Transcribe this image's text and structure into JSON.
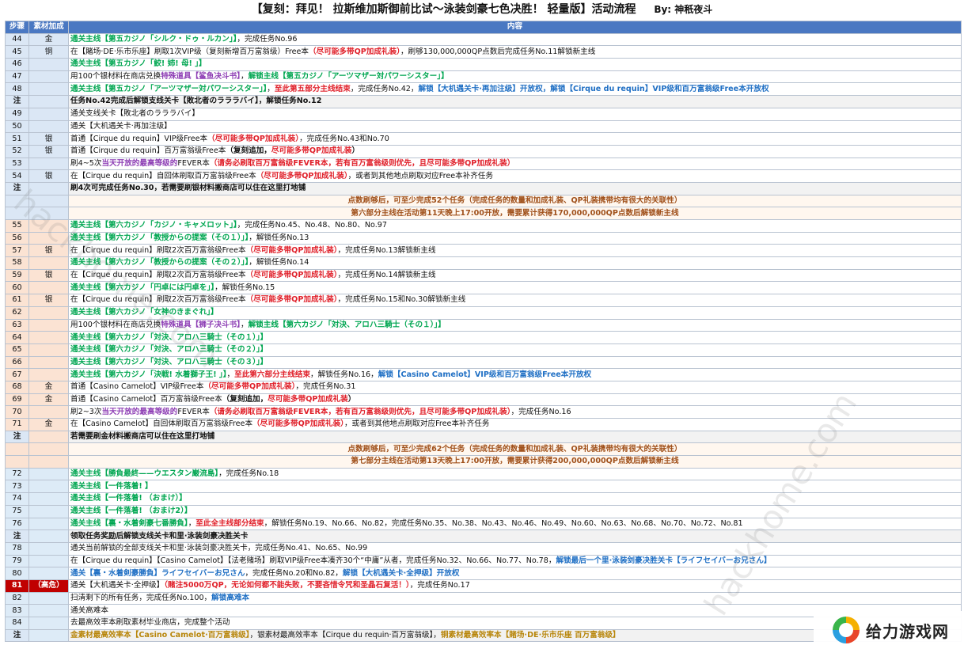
{
  "title": "【复刻：拜见！ 拉斯维加斯御前比试～泳装剑豪七色决胜！ 轻量版】活动流程",
  "author": "By:  神秖夜斗",
  "columns": [
    "步骤",
    "素材加成",
    "内容"
  ],
  "watermark": "hackhome.com",
  "watermark_left": "hackhome.com",
  "logo_text": "给力游戏网",
  "rows": [
    {
      "step": "44",
      "mat": "金",
      "band": "blue",
      "kind": "normal",
      "parts": [
        {
          "t": "通关主线【第五カジノ「シルク・ドゥ・ルカン」】",
          "c": "g"
        },
        {
          "t": "，完成任务No.96",
          "c": "n"
        }
      ]
    },
    {
      "step": "45",
      "mat": "铜",
      "band": "blue",
      "kind": "normal",
      "parts": [
        {
          "t": "在【賭场·DE·乐市乐座】刷取1次VIP级（复刻新增百万富翁级）Free本",
          "c": "n"
        },
        {
          "t": "（尽可能多带QP加成礼装）",
          "c": "r"
        },
        {
          "t": "，刷够130,000,000QP点数后完成任务No.11解锁新主线",
          "c": "n"
        }
      ]
    },
    {
      "step": "46",
      "mat": "",
      "band": "blue",
      "kind": "normal",
      "parts": [
        {
          "t": "通关主线【第五カジノ「鮫! 姉! 母! 」】",
          "c": "g"
        }
      ]
    },
    {
      "step": "47",
      "mat": "",
      "band": "blue",
      "kind": "normal",
      "parts": [
        {
          "t": "用100个银材料在商店兑换",
          "c": "n"
        },
        {
          "t": "特殊道具【鲨鱼决斗书】",
          "c": "p"
        },
        {
          "t": "，",
          "c": "n"
        },
        {
          "t": "解锁主线【第五カジノ「アーツマザー対パワーシスター」】",
          "c": "g"
        }
      ]
    },
    {
      "step": "48",
      "mat": "",
      "band": "blue",
      "kind": "normal",
      "parts": [
        {
          "t": "通关主线【第五カジノ「アーツマザー対パワーシスター」】",
          "c": "g"
        },
        {
          "t": "，",
          "c": "n"
        },
        {
          "t": "至此第五部分主线结束",
          "c": "r"
        },
        {
          "t": "，完成任务No.42，",
          "c": "n"
        },
        {
          "t": "解锁【大机遇关卡·再加注级】开放权，解锁【Cirque du requin】VIP级和百万富翁级Free本开放权",
          "c": "b"
        }
      ]
    },
    {
      "step": "注",
      "mat": "",
      "band": "blue",
      "kind": "note",
      "parts": [
        {
          "t": "任务No.42完成后解锁支线关卡【敗北者のラララバイ】，解锁任务No.12",
          "c": "k"
        }
      ]
    },
    {
      "step": "49",
      "mat": "",
      "band": "blue",
      "kind": "normal",
      "parts": [
        {
          "t": "通关支线关卡【敗北者のラララバイ】",
          "c": "n"
        }
      ]
    },
    {
      "step": "50",
      "mat": "",
      "band": "blue",
      "kind": "normal",
      "parts": [
        {
          "t": "通关【大机遇关卡·再加注级】",
          "c": "n"
        }
      ]
    },
    {
      "step": "51",
      "mat": "银",
      "band": "blue",
      "kind": "normal",
      "parts": [
        {
          "t": "首通【Cirque du requin】VIP级Free本",
          "c": "n"
        },
        {
          "t": "（尽可能多带QP加成礼装）",
          "c": "r"
        },
        {
          "t": "，完成任务No.43和No.70",
          "c": "n"
        }
      ]
    },
    {
      "step": "52",
      "mat": "银",
      "band": "blue",
      "kind": "normal",
      "parts": [
        {
          "t": "首通【Cirque du requin】百万富翁级Free本",
          "c": "n"
        },
        {
          "t": "（复刻追加，",
          "c": "k"
        },
        {
          "t": "尽可能多带QP加成礼装",
          "c": "r"
        },
        {
          "t": "）",
          "c": "k"
        }
      ]
    },
    {
      "step": "53",
      "mat": "",
      "band": "blue",
      "kind": "normal",
      "parts": [
        {
          "t": "刷4~5次",
          "c": "n"
        },
        {
          "t": "当天开放的最高等级的",
          "c": "p"
        },
        {
          "t": "FEVER本",
          "c": "n"
        },
        {
          "t": "（请务必刷取百万富翁级FEVER本，若有百万富翁级则优先，且尽可能多带QP加成礼装）",
          "c": "r"
        }
      ]
    },
    {
      "step": "54",
      "mat": "银",
      "band": "blue",
      "kind": "normal",
      "parts": [
        {
          "t": "在【Cirque du requin】自回体刷取百万富翁级Free本",
          "c": "n"
        },
        {
          "t": "（尽可能多带QP加成礼装）",
          "c": "r"
        },
        {
          "t": "，或者到其他地点刷取对应Free本补齐任务",
          "c": "n"
        }
      ]
    },
    {
      "step": "注",
      "mat": "",
      "band": "blue",
      "kind": "note",
      "parts": [
        {
          "t": "刷4次可完成任务No.30，若需要刷银材料搬商店可以住在这里打地铺",
          "c": "k"
        }
      ]
    },
    {
      "step": "",
      "mat": "",
      "band": "blue",
      "kind": "info",
      "parts": [
        {
          "t": "点数刷够后，可至少完成52个任务（完成任务的数量和加成礼装、QP礼装携带均有很大的关联性）",
          "c": "info"
        }
      ]
    },
    {
      "step": "",
      "mat": "",
      "band": "blue",
      "kind": "info",
      "parts": [
        {
          "t": "第六部分主线在活动第11天晚上17:00开放，需要累计获得170,000,000QP点数后解锁新主线",
          "c": "info"
        }
      ]
    },
    {
      "step": "55",
      "mat": "",
      "band": "peach",
      "kind": "normal",
      "parts": [
        {
          "t": "通关主线【第六カジノ「カジノ・キャメロット」】",
          "c": "g"
        },
        {
          "t": "，完成任务No.45、No.48、No.80、No.97",
          "c": "n"
        }
      ]
    },
    {
      "step": "56",
      "mat": "",
      "band": "peach",
      "kind": "normal",
      "parts": [
        {
          "t": "通关主线【第六カジノ「教授からの提案（その１）」】",
          "c": "g"
        },
        {
          "t": "，解锁任务No.13",
          "c": "n"
        }
      ]
    },
    {
      "step": "57",
      "mat": "银",
      "band": "peach",
      "kind": "normal",
      "parts": [
        {
          "t": "在【Cirque du requin】刷取2次百万富翁级Free本",
          "c": "n"
        },
        {
          "t": "（尽可能多带QP加成礼装）",
          "c": "r"
        },
        {
          "t": "，完成任务No.13解锁新主线",
          "c": "n"
        }
      ]
    },
    {
      "step": "58",
      "mat": "",
      "band": "peach",
      "kind": "normal",
      "parts": [
        {
          "t": "通关主线【第六カジノ「教授からの提案（その２）」】",
          "c": "g"
        },
        {
          "t": "，解锁任务No.14",
          "c": "n"
        }
      ]
    },
    {
      "step": "59",
      "mat": "银",
      "band": "peach",
      "kind": "normal",
      "parts": [
        {
          "t": "在【Cirque du requin】刷取2次百万富翁级Free本",
          "c": "n"
        },
        {
          "t": "（尽可能多带QP加成礼装）",
          "c": "r"
        },
        {
          "t": "，完成任务No.14解锁新主线",
          "c": "n"
        }
      ]
    },
    {
      "step": "60",
      "mat": "",
      "band": "peach",
      "kind": "normal",
      "parts": [
        {
          "t": "通关主线【第六カジノ「円卓には円卓を」】",
          "c": "g"
        },
        {
          "t": "，解锁任务No.15",
          "c": "n"
        }
      ]
    },
    {
      "step": "61",
      "mat": "银",
      "band": "peach",
      "kind": "normal",
      "parts": [
        {
          "t": "在【Cirque du requin】刷取2次百万富翁级Free本",
          "c": "n"
        },
        {
          "t": "（尽可能多带QP加成礼装）",
          "c": "r"
        },
        {
          "t": "，完成任务No.15和No.30解锁新主线",
          "c": "n"
        }
      ]
    },
    {
      "step": "62",
      "mat": "",
      "band": "peach",
      "kind": "normal",
      "parts": [
        {
          "t": "通关主线【第六カジノ「女神のきまぐれ」】",
          "c": "g"
        }
      ]
    },
    {
      "step": "63",
      "mat": "",
      "band": "peach",
      "kind": "normal",
      "parts": [
        {
          "t": "用100个银材料在商店兑换",
          "c": "n"
        },
        {
          "t": "特殊道具【狮子决斗书】",
          "c": "p"
        },
        {
          "t": "，",
          "c": "n"
        },
        {
          "t": "解锁主线【第六カジノ「対決、アロハ三騎士（その１）」】",
          "c": "g"
        }
      ]
    },
    {
      "step": "64",
      "mat": "",
      "band": "peach",
      "kind": "normal",
      "parts": [
        {
          "t": "通关主线【第六カジノ「対決、アロハ三騎士（その１）」】",
          "c": "g"
        }
      ]
    },
    {
      "step": "65",
      "mat": "",
      "band": "peach",
      "kind": "normal",
      "parts": [
        {
          "t": "通关主线【第六カジノ「対決、アロハ三騎士（その２）」】",
          "c": "g"
        }
      ]
    },
    {
      "step": "66",
      "mat": "",
      "band": "peach",
      "kind": "normal",
      "parts": [
        {
          "t": "通关主线【第六カジノ「対決、アロハ三騎士（その３）」】",
          "c": "g"
        }
      ]
    },
    {
      "step": "67",
      "mat": "",
      "band": "peach",
      "kind": "normal",
      "parts": [
        {
          "t": "通关主线【第六カジノ「決戦! 水着獅子王! 」】",
          "c": "g"
        },
        {
          "t": "，",
          "c": "n"
        },
        {
          "t": "至此第六部分主线结束",
          "c": "r"
        },
        {
          "t": "，解锁任务No.16，",
          "c": "n"
        },
        {
          "t": "解锁【Casino Camelot】VIP级和百万富翁级Free本开放权",
          "c": "b"
        }
      ]
    },
    {
      "step": "68",
      "mat": "金",
      "band": "peach",
      "kind": "normal",
      "parts": [
        {
          "t": "首通【Casino Camelot】VIP级Free本",
          "c": "n"
        },
        {
          "t": "（尽可能多带QP加成礼装）",
          "c": "r"
        },
        {
          "t": "，完成任务No.31",
          "c": "n"
        }
      ]
    },
    {
      "step": "69",
      "mat": "金",
      "band": "peach",
      "kind": "normal",
      "parts": [
        {
          "t": "首通【Casino Camelot】百万富翁级Free本",
          "c": "n"
        },
        {
          "t": "（复刻追加，",
          "c": "k"
        },
        {
          "t": "尽可能多带QP加成礼装",
          "c": "r"
        },
        {
          "t": "）",
          "c": "k"
        }
      ]
    },
    {
      "step": "70",
      "mat": "",
      "band": "peach",
      "kind": "normal",
      "parts": [
        {
          "t": "刷2~3次",
          "c": "n"
        },
        {
          "t": "当天开放的最高等级的",
          "c": "p"
        },
        {
          "t": "FEVER本",
          "c": "n"
        },
        {
          "t": "（请务必刷取百万富翁级FEVER本，若有百万富翁级则优先，且尽可能多带QP加成礼装）",
          "c": "r"
        },
        {
          "t": "，完成任务No.16",
          "c": "n"
        }
      ]
    },
    {
      "step": "71",
      "mat": "金",
      "band": "peach",
      "kind": "normal",
      "parts": [
        {
          "t": "在【Casino Camelot】自回体刷取百万富翁级Free本",
          "c": "n"
        },
        {
          "t": "（尽可能多带QP加成礼装）",
          "c": "r"
        },
        {
          "t": "，或者到其他地点刷取对应Free本补齐任务",
          "c": "n"
        }
      ]
    },
    {
      "step": "注",
      "mat": "",
      "band": "peach",
      "kind": "note",
      "parts": [
        {
          "t": "若需要刷金材料搬商店可以住在这里打地铺",
          "c": "k"
        }
      ]
    },
    {
      "step": "",
      "mat": "",
      "band": "peach",
      "kind": "info",
      "parts": [
        {
          "t": "点数刷够后，可至少完成62个任务（完成任务的数量和加成礼装、QP礼装携带均有很大的关联性）",
          "c": "info"
        }
      ]
    },
    {
      "step": "",
      "mat": "",
      "band": "peach",
      "kind": "info",
      "parts": [
        {
          "t": "第七部分主线在活动第13天晚上17:00开放，需要累计获得200,000,000QP点数后解锁新主线",
          "c": "info"
        }
      ]
    },
    {
      "step": "72",
      "mat": "",
      "band": "lblue",
      "kind": "normal",
      "parts": [
        {
          "t": "通关主线【勝負最終——ウエスタン巌流島】",
          "c": "g"
        },
        {
          "t": "，完成任务No.18",
          "c": "n"
        }
      ]
    },
    {
      "step": "73",
      "mat": "",
      "band": "lblue",
      "kind": "normal",
      "parts": [
        {
          "t": "通关主线【一件落着! 】",
          "c": "g"
        }
      ]
    },
    {
      "step": "74",
      "mat": "",
      "band": "lblue",
      "kind": "normal",
      "parts": [
        {
          "t": "通关主线【一件落着! （おまけ）】",
          "c": "g"
        }
      ]
    },
    {
      "step": "75",
      "mat": "",
      "band": "lblue",
      "kind": "normal",
      "parts": [
        {
          "t": "通关主线【一件落着! （おまけ2）】",
          "c": "g"
        }
      ]
    },
    {
      "step": "76",
      "mat": "",
      "band": "lblue",
      "kind": "normal",
      "parts": [
        {
          "t": "通关主线【裏・水着剣豪七番勝負】",
          "c": "g"
        },
        {
          "t": "，",
          "c": "n"
        },
        {
          "t": "至此全主线部分结束",
          "c": "r"
        },
        {
          "t": "，解锁任务No.19、No.66、No.82，完成任务No.35、No.38、No.43、No.46、No.49、No.60、No.63、No.68、No.70、No.72、No.81",
          "c": "n"
        }
      ]
    },
    {
      "step": "注",
      "mat": "",
      "band": "lblue",
      "kind": "note",
      "parts": [
        {
          "t": "领取任务奖励后解锁支线关卡和里·泳装剑豪决胜关卡",
          "c": "k"
        }
      ]
    },
    {
      "step": "78",
      "mat": "",
      "band": "lblue",
      "kind": "normal",
      "parts": [
        {
          "t": "通关当前解锁的全部支线关卡和里·泳装剑豪决胜关卡，完成任务No.41、No.65、No.99",
          "c": "n"
        }
      ]
    },
    {
      "step": "79",
      "mat": "",
      "band": "lblue",
      "kind": "normal",
      "parts": [
        {
          "t": "在【Cirque du requin】【Casino Camelot】【法老赌场】刷取VIP级Free本凑齐30个“中庸”从者，完成任务No.32、No.66、No.77、No.78，",
          "c": "n"
        },
        {
          "t": "解锁最后一个里·泳装剑豪决胜关卡【ライフセイバーお兄さん】",
          "c": "b"
        }
      ]
    },
    {
      "step": "80",
      "mat": "",
      "band": "lblue",
      "kind": "normal",
      "parts": [
        {
          "t": "通关【裏・水着剣豪勝負】ライフセイバーお兄さん",
          "c": "b"
        },
        {
          "t": "，完成任务No.20和No.82，",
          "c": "n"
        },
        {
          "t": "解锁【大机遇关卡·全押级】开放权",
          "c": "b"
        }
      ]
    },
    {
      "step": "81",
      "mat": "（高危）",
      "band": "lblue",
      "kind": "danger",
      "parts": [
        {
          "t": "通关【大机遇关卡·全押级】",
          "c": "n"
        },
        {
          "t": "（赌注5000万QP，无论如何都不能失败，不要吝惜令咒和圣晶石复活！）",
          "c": "r"
        },
        {
          "t": "，完成任务No.17",
          "c": "n"
        }
      ]
    },
    {
      "step": "82",
      "mat": "",
      "band": "lblue",
      "kind": "normal",
      "parts": [
        {
          "t": "扫清剩下的所有任务，完成任务No.100，",
          "c": "n"
        },
        {
          "t": "解锁高难本",
          "c": "b"
        }
      ]
    },
    {
      "step": "83",
      "mat": "",
      "band": "lblue",
      "kind": "normal",
      "parts": [
        {
          "t": "通关高难本",
          "c": "n"
        }
      ]
    },
    {
      "step": "84",
      "mat": "",
      "band": "lblue",
      "kind": "normal",
      "parts": [
        {
          "t": "去最高效率本刷取素材毕业商店，完成整个活动",
          "c": "n"
        }
      ]
    },
    {
      "step": "注",
      "mat": "",
      "band": "lblue",
      "kind": "note",
      "parts": [
        {
          "t": "金素材最高效率本【Casino Camelot·百万富翁级】",
          "c": "o"
        },
        {
          "t": "，银素材最高效率本【Cirque du requin·百万富翁级】，",
          "c": "n"
        },
        {
          "t": "铜素材最高效率本【賭场·DE·乐市乐座 百万富翁级】",
          "c": "o"
        }
      ]
    }
  ]
}
